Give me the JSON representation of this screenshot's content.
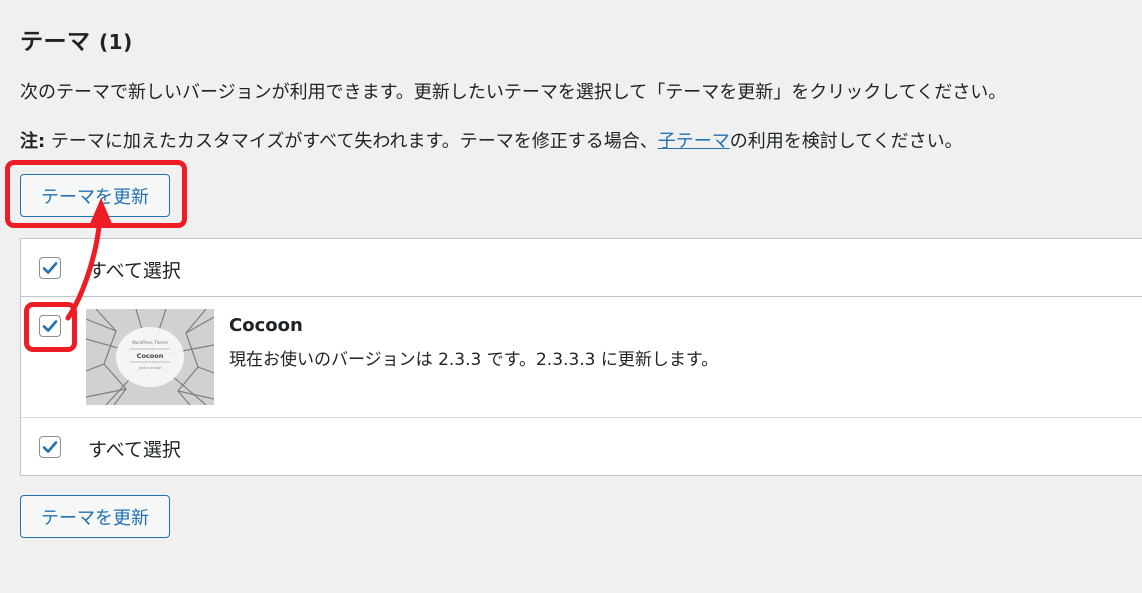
{
  "section": {
    "title": "テーマ",
    "count": "(1)"
  },
  "description": "次のテーマで新しいバージョンが利用できます。更新したいテーマを選択して「テーマを更新」をクリックしてください。",
  "note": {
    "label": "注:",
    "text_before": " テーマに加えたカスタマイズがすべて失われます。テーマを修正する場合、",
    "link": "子テーマ",
    "text_after": "の利用を検討してください。"
  },
  "update_button_label": "テーマを更新",
  "table": {
    "select_all_label": "すべて選択",
    "select_all_checked": true,
    "themes": [
      {
        "name": "Cocoon",
        "info": "現在お使いのバージョンは 2.3.3 です。2.3.3.3 に更新します。",
        "checked": true,
        "thumbnail": {
          "line1": "WordPress Theme",
          "line2": "Cocoon",
          "line3": "just a simple"
        }
      }
    ]
  },
  "colors": {
    "accent": "#2271b1",
    "annotation": "#ee1c25",
    "background": "#f0f0f1"
  }
}
